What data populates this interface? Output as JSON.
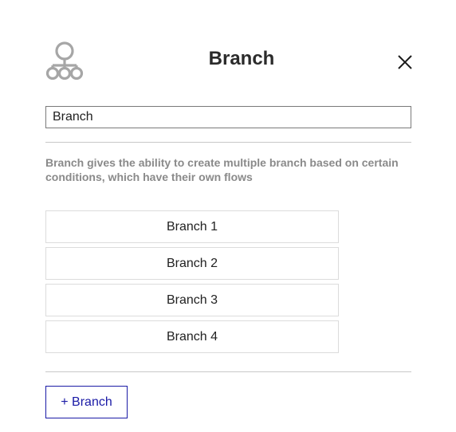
{
  "header": {
    "title": "Branch",
    "icon": "branch-tree-icon",
    "close_icon": "close-icon"
  },
  "name_input": {
    "value": "Branch"
  },
  "description": "Branch gives the ability to create multiple branch based on certain conditions, which have their own flows",
  "branches": [
    {
      "label": "Branch 1"
    },
    {
      "label": "Branch 2"
    },
    {
      "label": "Branch 3"
    },
    {
      "label": "Branch 4"
    }
  ],
  "add_button": {
    "label": "+ Branch"
  },
  "colors": {
    "accent": "#1a1aa6",
    "icon_gray": "#a6a6a6",
    "description_text": "#8a8a8a"
  }
}
